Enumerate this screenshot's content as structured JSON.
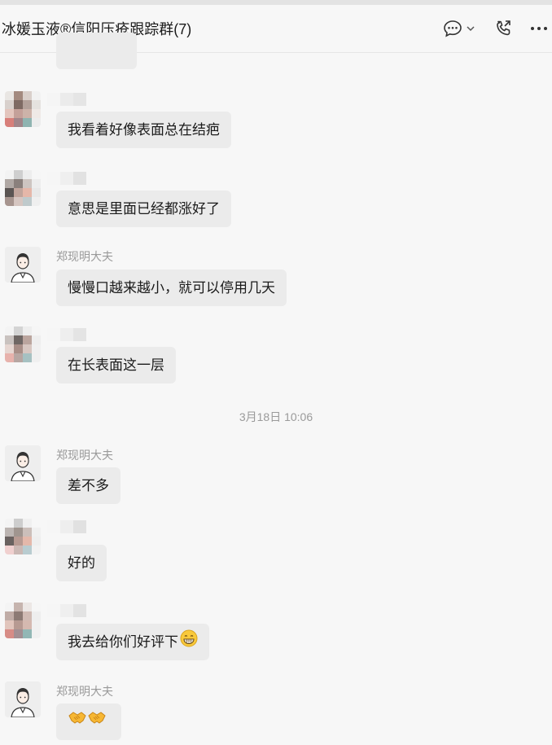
{
  "header": {
    "title": "冰媛玉液®信阳压疮跟踪群(7)",
    "icons": [
      "chat-options-icon",
      "chevron-down-icon",
      "voice-call-icon",
      "more-icon"
    ]
  },
  "doctor_name": "郑现明大夫",
  "timestamp": "3月18日 10:06",
  "messages": [
    {
      "text": "我看着好像表面总在结疤"
    },
    {
      "text": "意思是里面已经都涨好了"
    },
    {
      "text": "慢慢口越来越小，就可以停用几天"
    },
    {
      "text": "在长表面这一层"
    },
    {
      "text": "差不多"
    },
    {
      "text": "好的"
    },
    {
      "text": "我去给你们好评下",
      "emoji": "grinning-face"
    },
    {
      "text": "",
      "emoji": "handshake-handshake"
    }
  ],
  "colors": {
    "background": "#f7f7f7",
    "bubble": "#ebebeb",
    "meta_text": "#9a9a9a",
    "icon": "#333333"
  }
}
